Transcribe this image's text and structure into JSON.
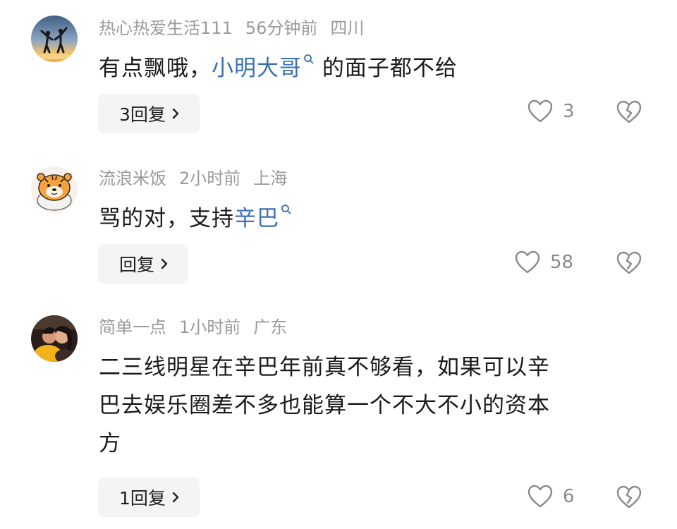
{
  "comments": [
    {
      "username": "热心热爱生活111",
      "time": "56分钟前",
      "location": "四川",
      "text_before": "有点飘哦，",
      "mention": "小明大哥",
      "text_after": " 的面子都不给",
      "reply_label": "3回复",
      "likes": "3",
      "avatar_icon": "silhouette-avatar-icon"
    },
    {
      "username": "流浪米饭",
      "time": "2小时前",
      "location": "上海",
      "text_before": "骂的对，支持",
      "mention": "辛巴",
      "text_after": "",
      "reply_label": "回复",
      "likes": "58",
      "avatar_icon": "tiger-avatar-icon"
    },
    {
      "username": "简单一点",
      "time": "1小时前",
      "location": "广东",
      "text_line1": "二三线明星在辛巴年前真不够看，如果可以辛",
      "text_line2": "巴去娱乐圈差不多也能算一个不大不小的资本",
      "text_line3": "方",
      "reply_label": "1回复",
      "likes": "6",
      "avatar_icon": "couple-avatar-icon"
    }
  ],
  "colors": {
    "mention": "#3a6fb0",
    "meta": "#9a9a9a",
    "reply_bg": "#f4f4f4"
  }
}
